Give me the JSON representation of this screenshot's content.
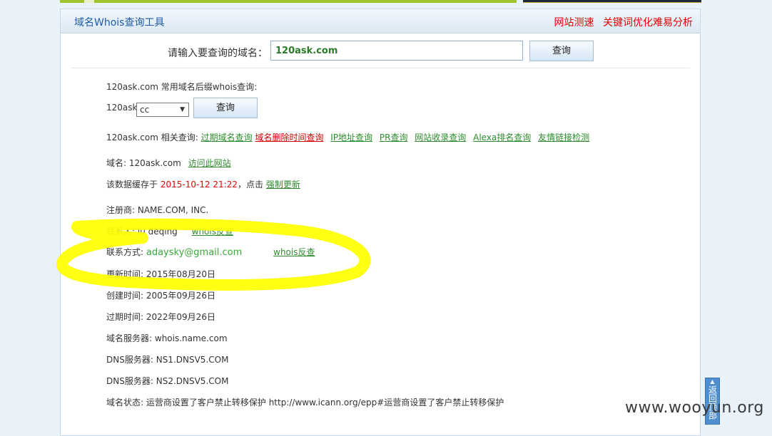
{
  "header": {
    "title": "域名Whois查询工具",
    "links": [
      "网站测速",
      "关键词优化难易分析"
    ]
  },
  "query": {
    "label": "请输入要查询的域名：",
    "value": "120ask.com",
    "button": "查询"
  },
  "suffix": {
    "label": "120ask.com 常用域名后缀whois查询:",
    "prefix": "120ask.",
    "selected": "cc",
    "button": "查询"
  },
  "related": {
    "label": "120ask.com 相关查询:",
    "links": [
      "过期域名查询",
      "域名删除时间查询",
      "IP地址查询",
      "PR查询",
      "网站收录查询",
      "Alexa排名查询",
      "友情链接检测"
    ]
  },
  "domain": {
    "label": "域名:",
    "value": "120ask.com",
    "visit": "访问此网站"
  },
  "cache": {
    "prefix": "该数据缓存于",
    "time": "2015-10-12 21:22",
    "middle": "，点击",
    "refresh": "强制更新"
  },
  "whois": {
    "registrar_label": "注册商:",
    "registrar": "NAME.COM, INC.",
    "contact_label": "联系人:",
    "contact": "lu deqing",
    "contact_link": "whois反查",
    "email_label": "联系方式:",
    "email": "adaysky@gmail.com",
    "email_link": "whois反查",
    "updated_label": "更新时间:",
    "updated": "2015年08月20日",
    "created_label": "创建时间:",
    "created": "2005年09月26日",
    "expires_label": "过期时间:",
    "expires": "2022年09月26日",
    "whois_server_label": "域名服务器:",
    "whois_server": "whois.name.com",
    "dns1_label": "DNS服务器:",
    "dns1": "NS1.DNSV5.COM",
    "dns2_label": "DNS服务器:",
    "dns2": "NS2.DNSV5.COM",
    "status_label": "域名状态:",
    "status": "运营商设置了客户禁止转移保护 http://www.icann.org/epp#运营商设置了客户禁止转移保护"
  },
  "back_top": "返回顶部",
  "watermark": "www.wooyun.org",
  "colors": {
    "highlight": "#ffff00",
    "link_green": "#2e8b2e",
    "alert_red": "#e50000"
  }
}
